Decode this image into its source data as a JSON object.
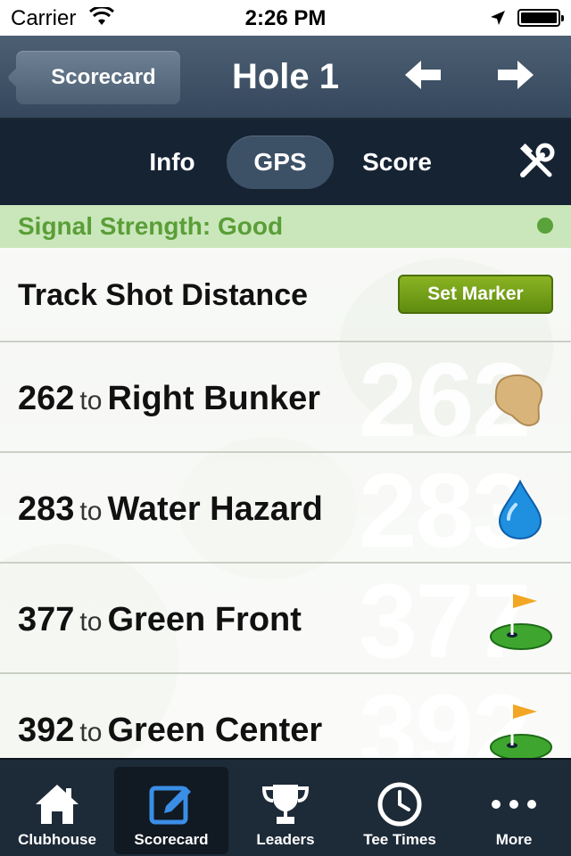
{
  "status_bar": {
    "carrier": "Carrier",
    "time": "2:26 PM"
  },
  "nav": {
    "back_label": "Scorecard",
    "title": "Hole 1",
    "prev_icon": "arrow-left-icon",
    "next_icon": "arrow-right-icon"
  },
  "segments": {
    "info": "Info",
    "gps": "GPS",
    "score": "Score",
    "selected": "GPS"
  },
  "signal": {
    "text": "Signal Strength: Good",
    "color": "#5aa23a"
  },
  "track": {
    "label": "Track Shot Distance",
    "button": "Set Marker"
  },
  "distances": [
    {
      "yards": "262",
      "to": "to",
      "target": "Right Bunker",
      "icon": "bunker-icon"
    },
    {
      "yards": "283",
      "to": "to",
      "target": "Water Hazard",
      "icon": "water-drop-icon"
    },
    {
      "yards": "377",
      "to": "to",
      "target": "Green Front",
      "icon": "green-flag-icon"
    },
    {
      "yards": "392",
      "to": "to",
      "target": "Green Center",
      "icon": "green-flag-icon"
    }
  ],
  "tabs": [
    {
      "label": "Clubhouse",
      "icon": "house-icon"
    },
    {
      "label": "Scorecard",
      "icon": "edit-icon",
      "active": true
    },
    {
      "label": "Leaders",
      "icon": "trophy-icon"
    },
    {
      "label": "Tee Times",
      "icon": "clock-icon"
    },
    {
      "label": "More",
      "icon": "more-dots-icon"
    }
  ],
  "colors": {
    "nav": "#3f5267",
    "segbar": "#162333",
    "tabbar": "#1d2a38",
    "accent_green": "#6f9b16",
    "active_tab_icon": "#3a8ee6"
  }
}
